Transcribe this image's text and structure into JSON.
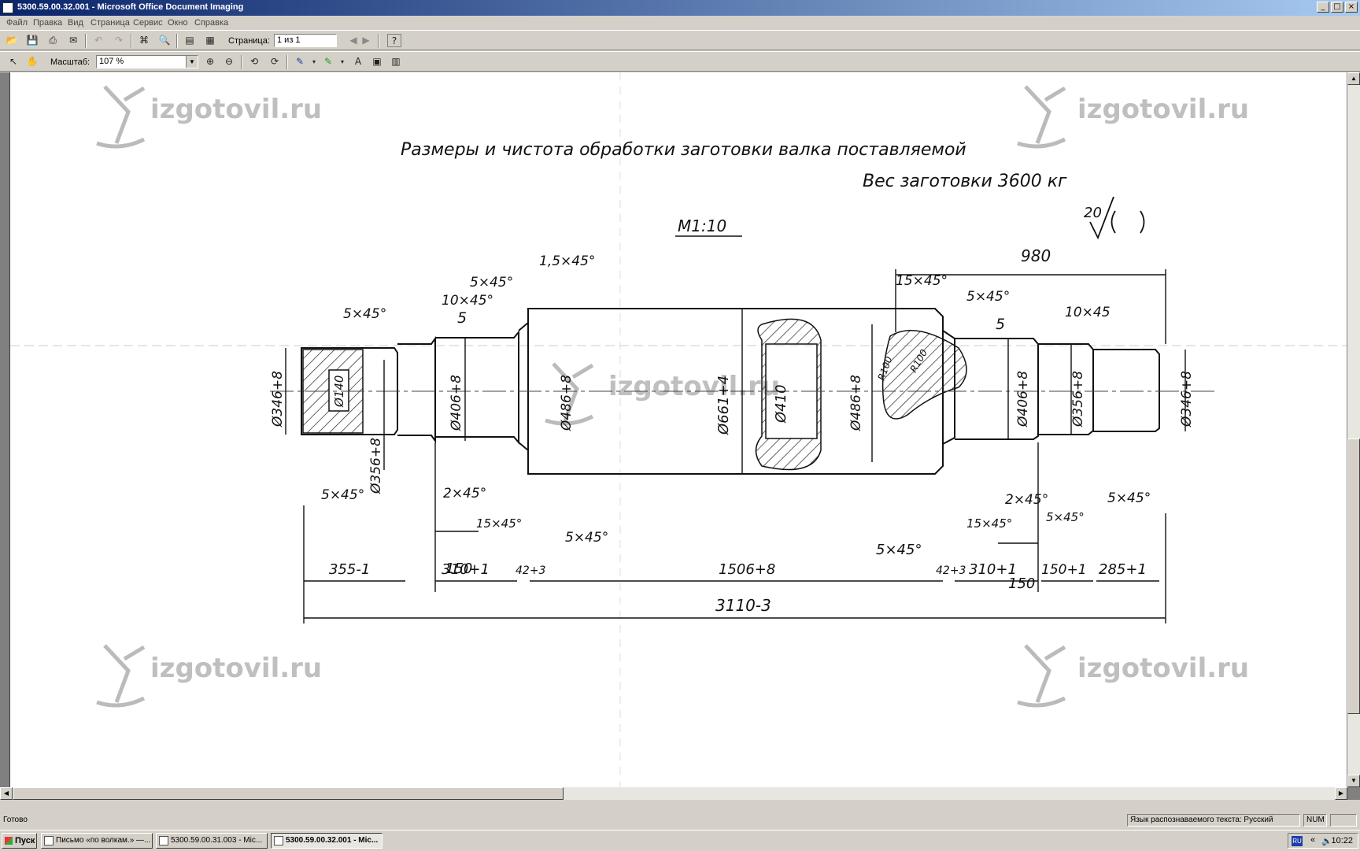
{
  "window": {
    "title": "5300.59.00.32.001 - Microsoft Office Document Imaging",
    "controls": [
      "_",
      "□",
      "×"
    ]
  },
  "menu": [
    "Файл",
    "Правка",
    "Вид",
    "Страница",
    "Сервис",
    "Окно",
    "Справка"
  ],
  "toolbar1": {
    "page_label": "Страница:",
    "page_value": "1 из 1",
    "help": "?"
  },
  "toolbar2": {
    "zoom_label": "Масштаб:",
    "zoom_value": "107 %"
  },
  "drawing": {
    "title_line1": "Размеры и чистота  обработки  заготовки валка поставляемой",
    "title_line2": "Вес  заготовки 3600 кг",
    "scale": "М1:10",
    "roughness": "20",
    "watermark": "izgotovil.ru",
    "dims": {
      "d346_left": "Ø346+8",
      "d140": "Ø140",
      "d356_left": "Ø356+8",
      "d406_left": "Ø406+8",
      "d486_left": "Ø486+8",
      "d661": "Ø661+4",
      "d410": "Ø410",
      "d486_right": "Ø486+8",
      "d406_right": "Ø406+8",
      "d356_right": "Ø356+8",
      "d346_right": "Ø346+8",
      "r100a": "R100",
      "r100b": "R100",
      "ch_1_5": "1,5×45°",
      "ch_5_top": "5×45°",
      "ch_10_left": "10×45°",
      "ch_5_far_left": "5×45°",
      "five_left": "5",
      "ch_5_bottom_left": "5×45°",
      "ch_2_left": "2×45°",
      "ch_15_left": "15×45°",
      "ch_5_mid": "5×45°",
      "len_150_left": "150",
      "ch_15_right_top": "15×45°",
      "ch_5_right_top": "5×45°",
      "len_980": "980",
      "ch_10_right": "10×45",
      "five_right": "5",
      "ch_2_right": "2×45°",
      "ch_5_far_right": "5×45°",
      "ch_15_right": "15×45°",
      "ch_5_right_low": "5×45°",
      "ch_5_bottom_mid": "5×45°",
      "len_150_right": "150",
      "len_355": "355-1",
      "len_310_left": "310+1",
      "len_42_left": "42+3",
      "len_1506": "1506+8",
      "len_42_right": "42+3",
      "len_310_right": "310+1",
      "len_150p": "150+1",
      "len_285": "285+1",
      "len_3110": "3110-3"
    }
  },
  "status": {
    "left": "Готово",
    "language": "Язык распознаваемого текста: Русский",
    "num": "NUM"
  },
  "taskbar": {
    "start": "Пуск",
    "tasks": [
      "Письмо «по волкам.» —...",
      "5300.59.00.31.003 - Mic...",
      "5300.59.00.32.001 - Mic..."
    ],
    "clock": "10:22",
    "lang": "RU"
  }
}
